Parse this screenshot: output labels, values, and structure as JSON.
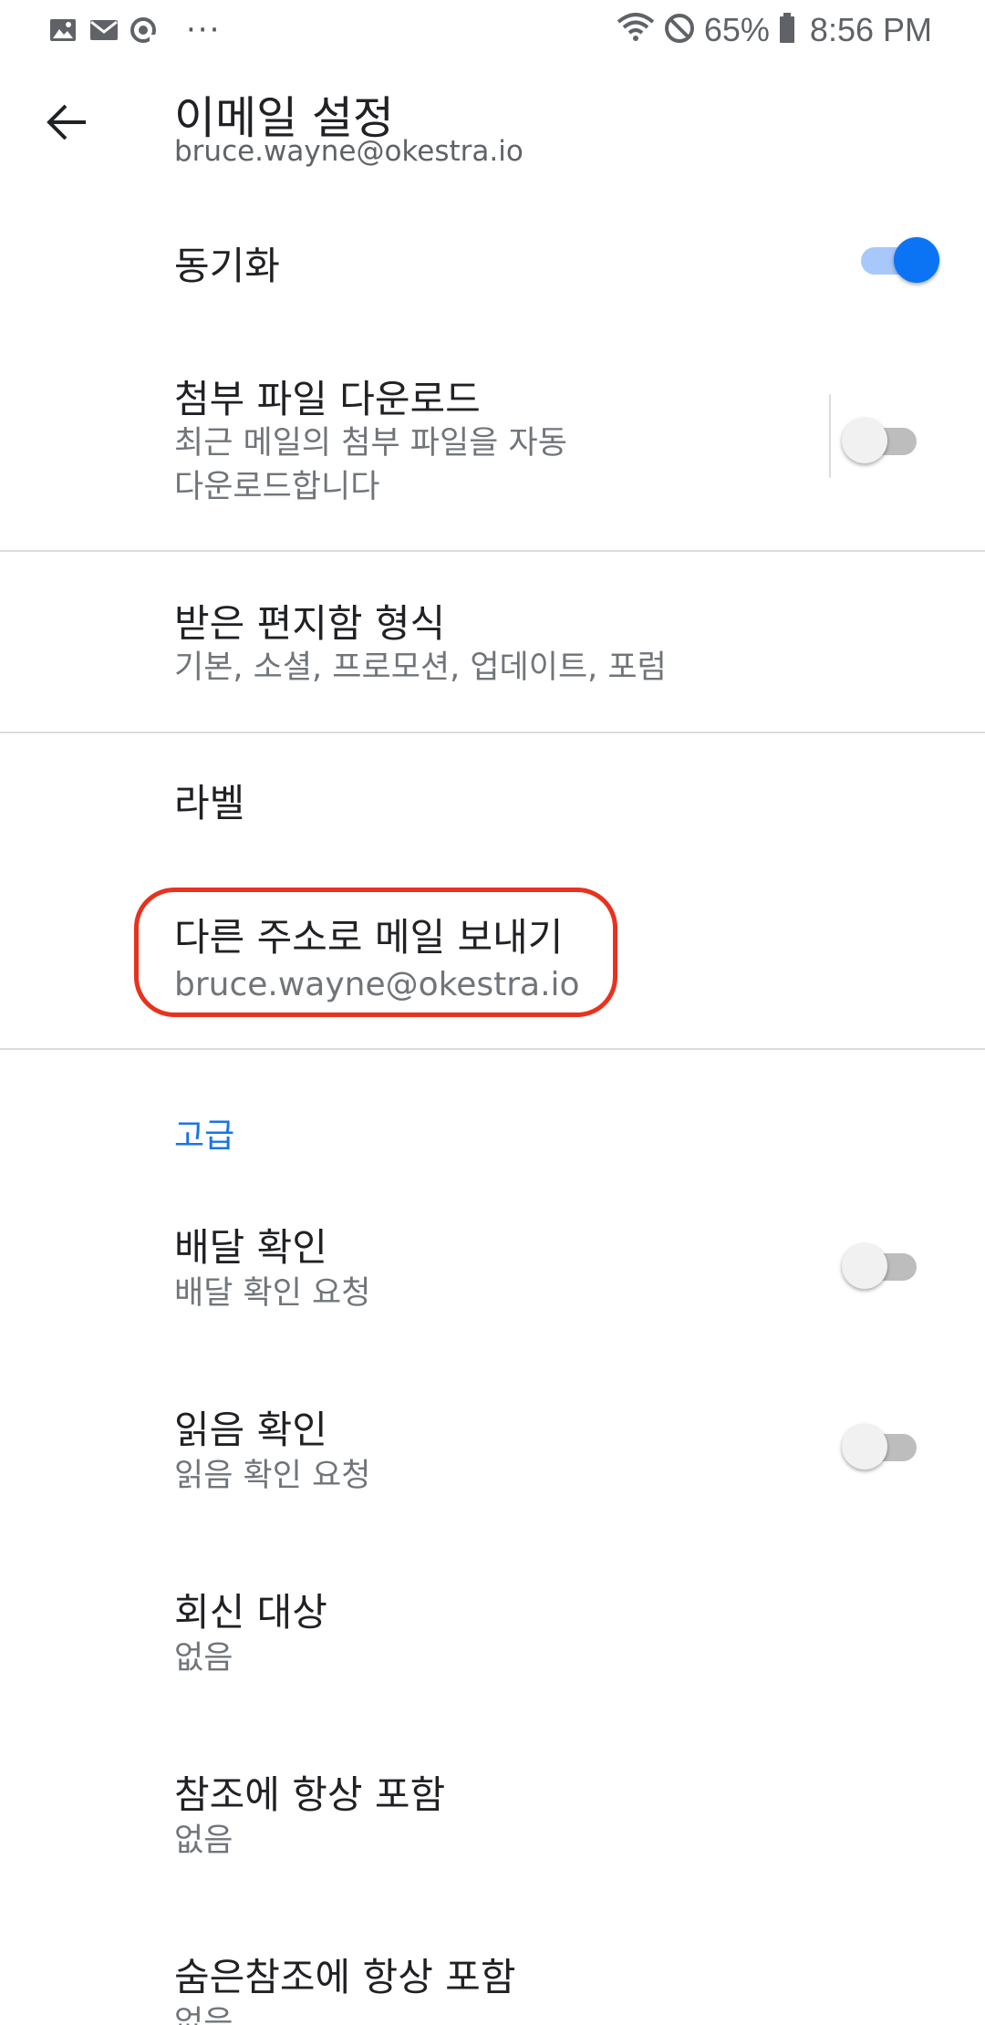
{
  "status_bar": {
    "left_icons": [
      "image-icon",
      "gmail-icon",
      "sync-icon"
    ],
    "more_dots": "···",
    "battery_pct": "65%",
    "time": "8:56 PM"
  },
  "header": {
    "title": "이메일 설정",
    "subtitle": "bruce.wayne@okestra.io"
  },
  "settings": {
    "sync": {
      "title": "동기화",
      "enabled": true
    },
    "attachments": {
      "title": "첨부 파일 다운로드",
      "sub_line1": "최근 메일의 첨부 파일을 자동",
      "sub_line2": "다운로드합니다",
      "enabled": false
    },
    "inbox_type": {
      "title": "받은 편지함 형식",
      "sub": "기본, 소셜, 프로모션, 업데이트, 포럼"
    },
    "labels": {
      "title": "라벨"
    },
    "send_as": {
      "title": "다른 주소로 메일 보내기",
      "sub": "bruce.wayne@okestra.io"
    }
  },
  "advanced": {
    "section_label": "고급",
    "delivery_receipt": {
      "title": "배달 확인",
      "sub": "배달 확인 요청",
      "enabled": false
    },
    "read_receipt": {
      "title": "읽음 확인",
      "sub": "읽음 확인 요청",
      "enabled": false
    },
    "reply_to": {
      "title": "회신 대상",
      "sub": "없음"
    },
    "always_cc": {
      "title": "참조에 항상 포함",
      "sub": "없음"
    },
    "always_bcc": {
      "title": "숨은참조에 항상 포함",
      "sub": "없음"
    }
  },
  "colors": {
    "accent": "#1a73e8",
    "toggle_on": "#0b74f5",
    "highlight": "#e8321e"
  }
}
